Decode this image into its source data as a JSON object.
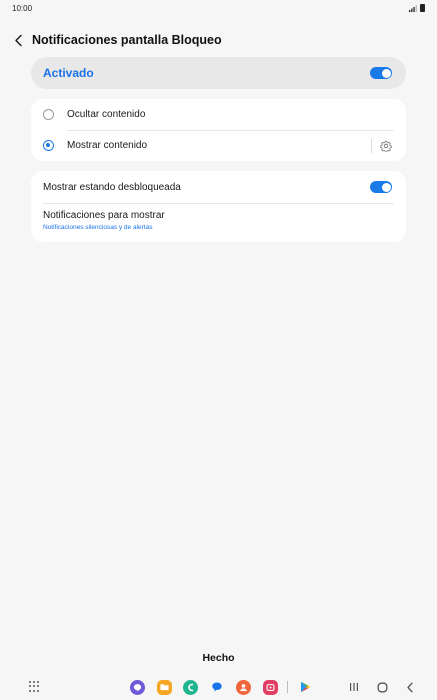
{
  "status_bar": {
    "time": "10:00"
  },
  "header": {
    "title": "Notificaciones pantalla Bloqueo"
  },
  "master": {
    "label": "Activado",
    "enabled": true
  },
  "content_options": {
    "items": [
      {
        "label": "Ocultar contenido",
        "selected": false
      },
      {
        "label": "Mostrar contenido",
        "selected": true
      }
    ]
  },
  "lock_options": {
    "show_unlocked": {
      "label": "Mostrar estando desbloqueada",
      "enabled": true
    },
    "notifications_to_show": {
      "label": "Notificaciones para mostrar",
      "value": "Notificaciones silenciosas y de alertas"
    }
  },
  "footer": {
    "done_label": "Hecho"
  },
  "colors": {
    "accent": "#1b72e8",
    "toggle_on": "#1a7be8",
    "background": "#f6f6f6"
  },
  "icons": {
    "back": "chevron-left-icon",
    "gear": "gear-icon",
    "apps": "apps-grid-icon",
    "recents": "recents-icon",
    "home": "home-icon",
    "nav_back": "nav-back-icon"
  }
}
